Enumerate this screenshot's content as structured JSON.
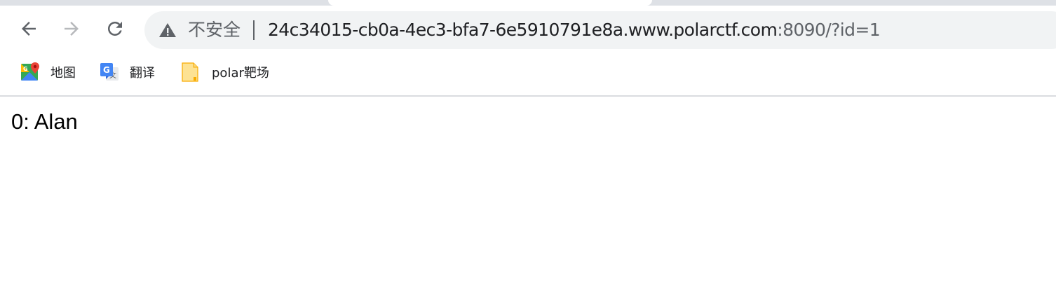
{
  "browser": {
    "security_label": "不安全",
    "url_host": "24c34015-cb0a-4ec3-bfa7-6e5910791e8a.www.polarctf.com",
    "url_rest": ":8090/?id=1",
    "icons": {
      "back": "arrow-back-icon",
      "forward": "arrow-forward-icon",
      "reload": "reload-icon",
      "warning": "not-secure-warning-icon"
    }
  },
  "bookmarks": [
    {
      "label": "地图",
      "icon": "google-maps-icon"
    },
    {
      "label": "翻译",
      "icon": "google-translate-icon"
    },
    {
      "label": "polar靶场",
      "icon": "folder-page-icon"
    }
  ],
  "page": {
    "text": "0: Alan"
  }
}
